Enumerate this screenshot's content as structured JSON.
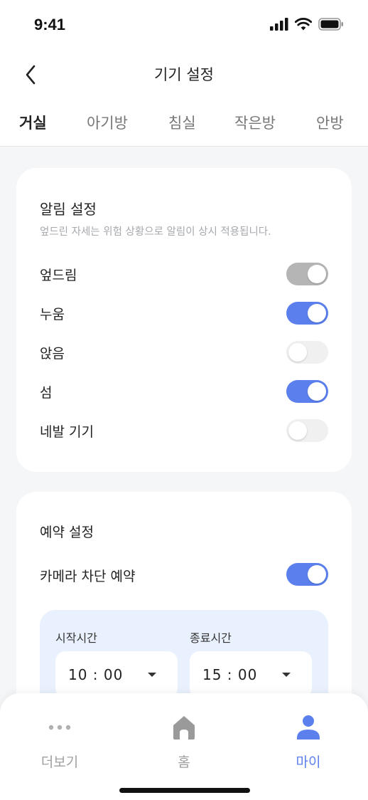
{
  "status_bar": {
    "time": "9:41"
  },
  "header": {
    "title": "기기 설정"
  },
  "tabs": [
    {
      "label": "거실",
      "active": true
    },
    {
      "label": "아기방",
      "active": false
    },
    {
      "label": "침실",
      "active": false
    },
    {
      "label": "작은방",
      "active": false
    },
    {
      "label": "안방",
      "active": false
    }
  ],
  "alert_settings": {
    "title": "알림 설정",
    "subtitle": "엎드린 자세는 위험 상황으로 알림이 상시 적용됩니다.",
    "rows": [
      {
        "label": "엎드림",
        "enabled": true,
        "locked": true
      },
      {
        "label": "누움",
        "enabled": true,
        "locked": false
      },
      {
        "label": "앉음",
        "enabled": false,
        "locked": false
      },
      {
        "label": "섬",
        "enabled": true,
        "locked": false
      },
      {
        "label": "네발 기기",
        "enabled": false,
        "locked": false
      }
    ]
  },
  "schedule_settings": {
    "title": "예약 설정",
    "camera_block_label": "카메라 차단 예약",
    "camera_block_enabled": true,
    "start_label": "시작시간",
    "start_value": "10 : 00",
    "end_label": "종료시간",
    "end_value": "15 : 00"
  },
  "bottom_nav": [
    {
      "label": "더보기",
      "icon": "more-dots-icon",
      "active": false
    },
    {
      "label": "홈",
      "icon": "home-icon",
      "active": false
    },
    {
      "label": "마이",
      "icon": "person-icon",
      "active": true
    }
  ],
  "colors": {
    "accent": "#5b80ee",
    "locked_toggle": "#b5b5b5",
    "off_toggle": "#f0f0f0",
    "time_panel": "#eaf1fe",
    "background": "#f5f6f8"
  }
}
